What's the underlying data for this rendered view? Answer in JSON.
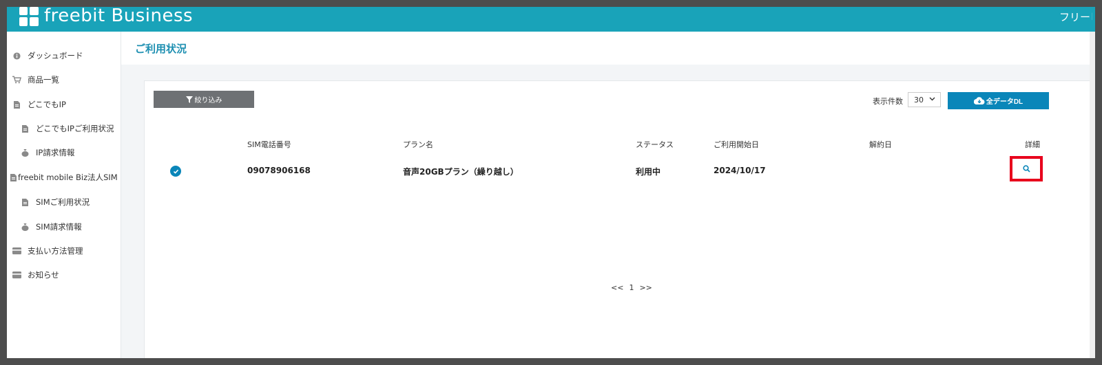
{
  "header": {
    "brand": "freebit Business",
    "user": "フリービ"
  },
  "sidebar": {
    "items": [
      {
        "label": "ダッシュボード",
        "icon": "info-icon"
      },
      {
        "label": "商品一覧",
        "icon": "cart-icon"
      },
      {
        "label": "どこでもIP",
        "icon": "document-icon"
      },
      {
        "label": "どこでもIPご利用状況",
        "icon": "document-icon"
      },
      {
        "label": "IP請求情報",
        "icon": "money-bag-icon"
      },
      {
        "label": "freebit mobile Biz法人SIM",
        "icon": "document-icon"
      },
      {
        "label": "SIMご利用状況",
        "icon": "document-icon"
      },
      {
        "label": "SIM請求情報",
        "icon": "money-bag-icon"
      },
      {
        "label": "支払い方法管理",
        "icon": "credit-card-icon"
      },
      {
        "label": "お知らせ",
        "icon": "credit-card-icon"
      }
    ]
  },
  "page": {
    "title": "ご利用状況"
  },
  "toolbar": {
    "filter_label": "絞り込み",
    "count_label": "表示件数",
    "count_value": "30",
    "download_label": "全データDL"
  },
  "table": {
    "headers": {
      "phone": "SIM電話番号",
      "plan": "プラン名",
      "status": "ステータス",
      "start": "ご利用開始日",
      "cancel": "解約日",
      "detail": "詳細"
    },
    "rows": [
      {
        "phone": "09078906168",
        "plan": "音声20GBプラン（繰り越し）",
        "status": "利用中",
        "start": "2024/10/17",
        "cancel": ""
      }
    ]
  },
  "pagination": {
    "prev": "<<",
    "page": "1",
    "next": ">>"
  },
  "colors": {
    "header": "#19a3b9",
    "primary": "#0a86b9",
    "highlight": "#e8001c",
    "filter_button": "#6e7174"
  }
}
